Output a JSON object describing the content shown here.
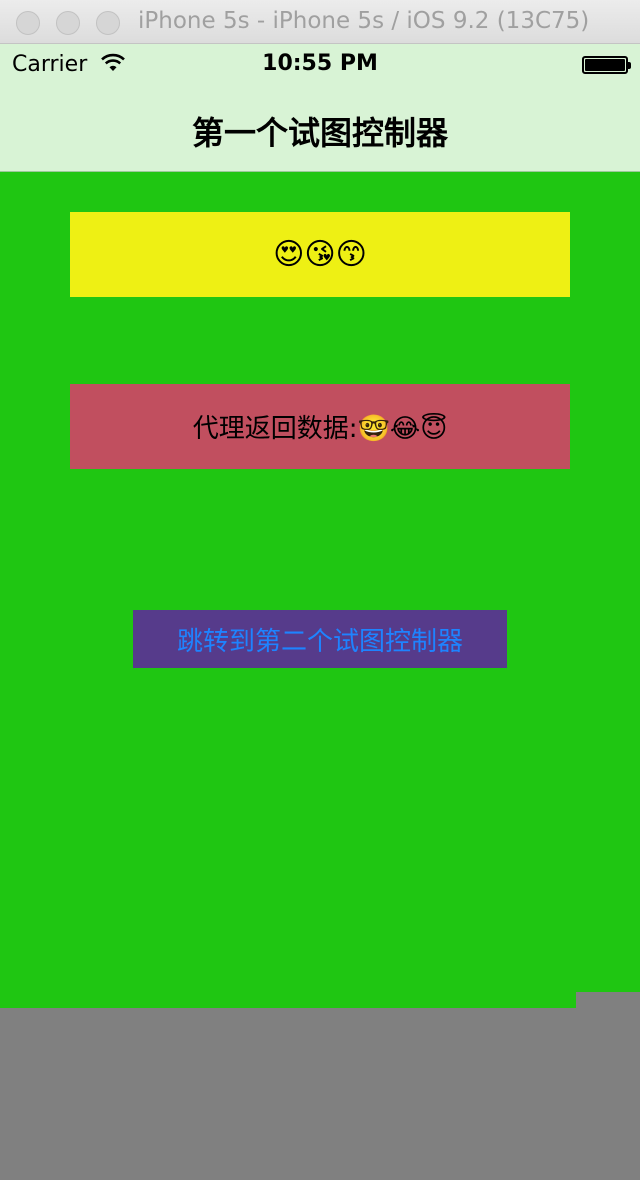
{
  "simulator": {
    "title": "iPhone 5s - iPhone 5s / iOS 9.2 (13C75)"
  },
  "status_bar": {
    "carrier": "Carrier",
    "time": "10:55 PM",
    "wifi_icon": "wifi-icon",
    "battery_icon": "battery-icon"
  },
  "nav_bar": {
    "title": "第一个试图控制器"
  },
  "content": {
    "background_color": "#1fc612",
    "emoji_label": "😍😘😙",
    "emoji_label_bg": "#eef014",
    "delegate_label": "代理返回数据:🤓😂😇",
    "delegate_label_bg": "#c14f5f",
    "jump_button_label": "跳转到第二个试图控制器",
    "jump_button_bg": "#563b8b",
    "jump_button_color": "#1e83ff"
  }
}
